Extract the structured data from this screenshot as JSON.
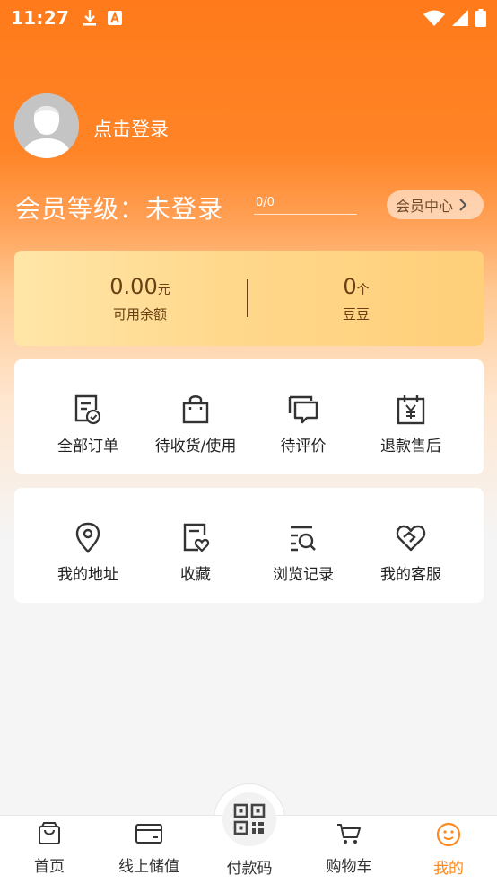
{
  "status_bar": {
    "time": "11:27",
    "icons": [
      "download-icon",
      "a-icon",
      "wifi-icon",
      "signal-icon",
      "battery-icon"
    ]
  },
  "profile": {
    "login_text": "点击登录"
  },
  "membership": {
    "level_text": "会员等级：未登录",
    "progress_text": "0/0",
    "center_button": "会员中心"
  },
  "wallet": {
    "balance": {
      "value": "0.00",
      "unit": "元",
      "label": "可用余额"
    },
    "beans": {
      "value": "0",
      "unit": "个",
      "label": "豆豆"
    }
  },
  "orders": [
    {
      "label": "全部订单",
      "icon": "order-list-icon"
    },
    {
      "label": "待收货/使用",
      "icon": "shopping-bag-icon"
    },
    {
      "label": "待评价",
      "icon": "comment-icon"
    },
    {
      "label": "退款售后",
      "icon": "refund-calendar-icon"
    }
  ],
  "services": [
    {
      "label": "我的地址",
      "icon": "location-pin-icon"
    },
    {
      "label": "收藏",
      "icon": "favorite-icon"
    },
    {
      "label": "浏览记录",
      "icon": "browse-history-icon"
    },
    {
      "label": "我的客服",
      "icon": "customer-service-icon"
    }
  ],
  "nav": [
    {
      "label": "首页",
      "icon": "home-bag-icon"
    },
    {
      "label": "线上储值",
      "icon": "card-icon"
    },
    {
      "label": "付款码",
      "icon": "qr-code-icon"
    },
    {
      "label": "购物车",
      "icon": "cart-icon"
    },
    {
      "label": "我的",
      "icon": "smile-icon",
      "active": true
    }
  ],
  "colors": {
    "accent": "#ff7a1a",
    "active_tab": "#ff8a1f",
    "wallet_text": "#6a3f14"
  }
}
